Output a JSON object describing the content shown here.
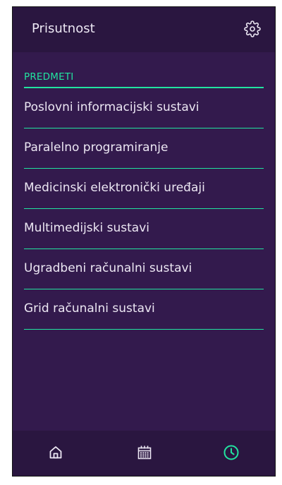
{
  "app": {
    "title": "Prisutnost"
  },
  "subjects": {
    "header": "PREDMETI",
    "items": [
      {
        "label": "Poslovni informacijski sustavi"
      },
      {
        "label": "Paralelno programiranje"
      },
      {
        "label": "Medicinski elektronički uređaji"
      },
      {
        "label": "Multimedijski sustavi"
      },
      {
        "label": "Ugradbeni računalni sustavi"
      },
      {
        "label": "Grid računalni sustavi"
      }
    ]
  },
  "bottom_nav": {
    "items": [
      {
        "icon": "home-icon",
        "active": false
      },
      {
        "icon": "calendar-icon",
        "active": false
      },
      {
        "icon": "clock-icon",
        "active": true
      }
    ]
  },
  "colors": {
    "background": "#331a4d",
    "bars": "#2a1640",
    "accent": "#22e3a0",
    "text": "#ece7f3"
  }
}
